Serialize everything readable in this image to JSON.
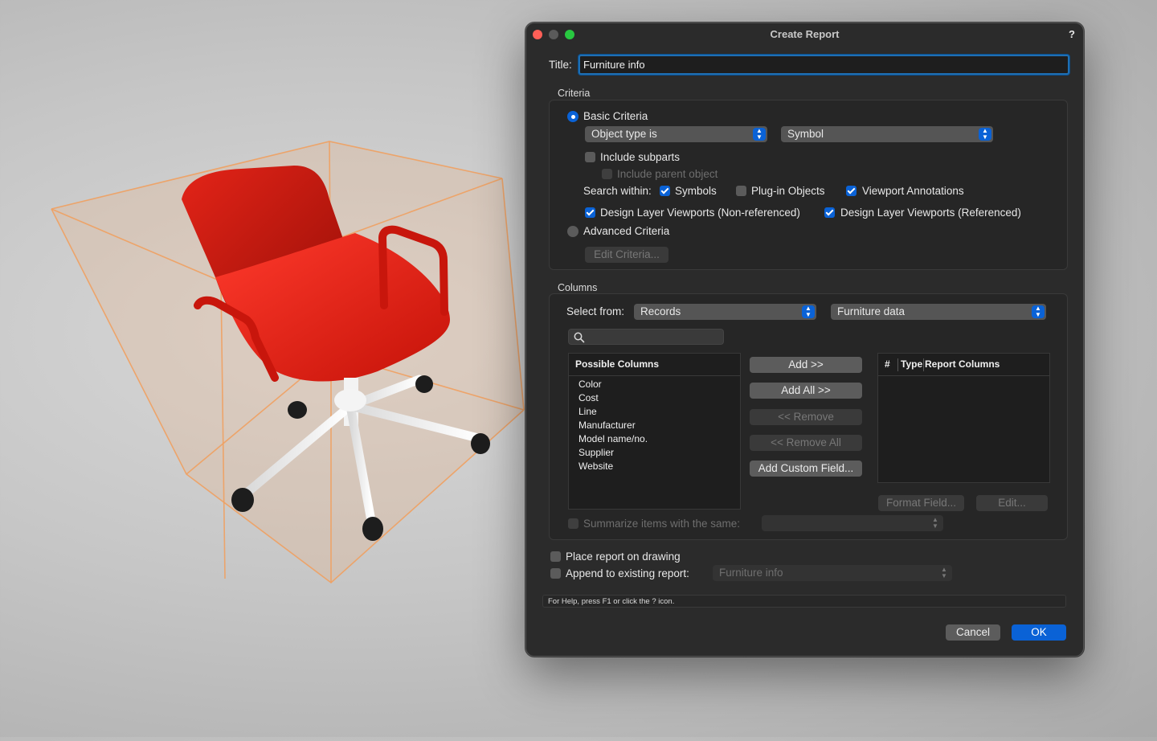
{
  "dialog": {
    "title": "Create Report",
    "help_glyph": "?",
    "title_label": "Title:",
    "title_value": "Furniture info",
    "criteria": {
      "section_label": "Criteria",
      "basic_label": "Basic Criteria",
      "basic_selected": true,
      "field1": "Object type is",
      "field2": "Symbol",
      "include_subparts": "Include subparts",
      "include_parent": "Include parent object",
      "search_within_label": "Search within:",
      "symbols": "Symbols",
      "plugin_objects": "Plug-in Objects",
      "viewport_annotations": "Viewport Annotations",
      "dlv_nonref": "Design Layer Viewports (Non-referenced)",
      "dlv_ref": "Design Layer Viewports (Referenced)",
      "advanced_label": "Advanced Criteria",
      "edit_criteria": "Edit Criteria..."
    },
    "columns": {
      "section_label": "Columns",
      "select_from_label": "Select from:",
      "select_from_value": "Records",
      "record_value": "Furniture data",
      "search_placeholder": "",
      "possible_header": "Possible Columns",
      "possible": [
        "Color",
        "Cost",
        "Line",
        "Manufacturer",
        "Model name/no.",
        "Supplier",
        "Website"
      ],
      "add": "Add >>",
      "add_all": "Add All >>",
      "remove": "<< Remove",
      "remove_all": "<< Remove All",
      "add_custom": "Add Custom Field...",
      "report_hash": "#",
      "report_type": "Type",
      "report_header": "Report Columns",
      "format_field": "Format Field...",
      "edit": "Edit...",
      "summarize_label": "Summarize items with the same:"
    },
    "place_report": "Place report on drawing",
    "append_report": "Append to existing report:",
    "append_value": "Furniture info",
    "status": "For Help, press F1 or click the ? icon.",
    "cancel": "Cancel",
    "ok": "OK"
  },
  "colors": {
    "accent": "#0a62d6",
    "chair_red": "#e32015",
    "bbox_orange": "#f0a060"
  },
  "icons": {
    "search": "search-icon",
    "popup_arrows": "up-down-chevron-icon"
  }
}
